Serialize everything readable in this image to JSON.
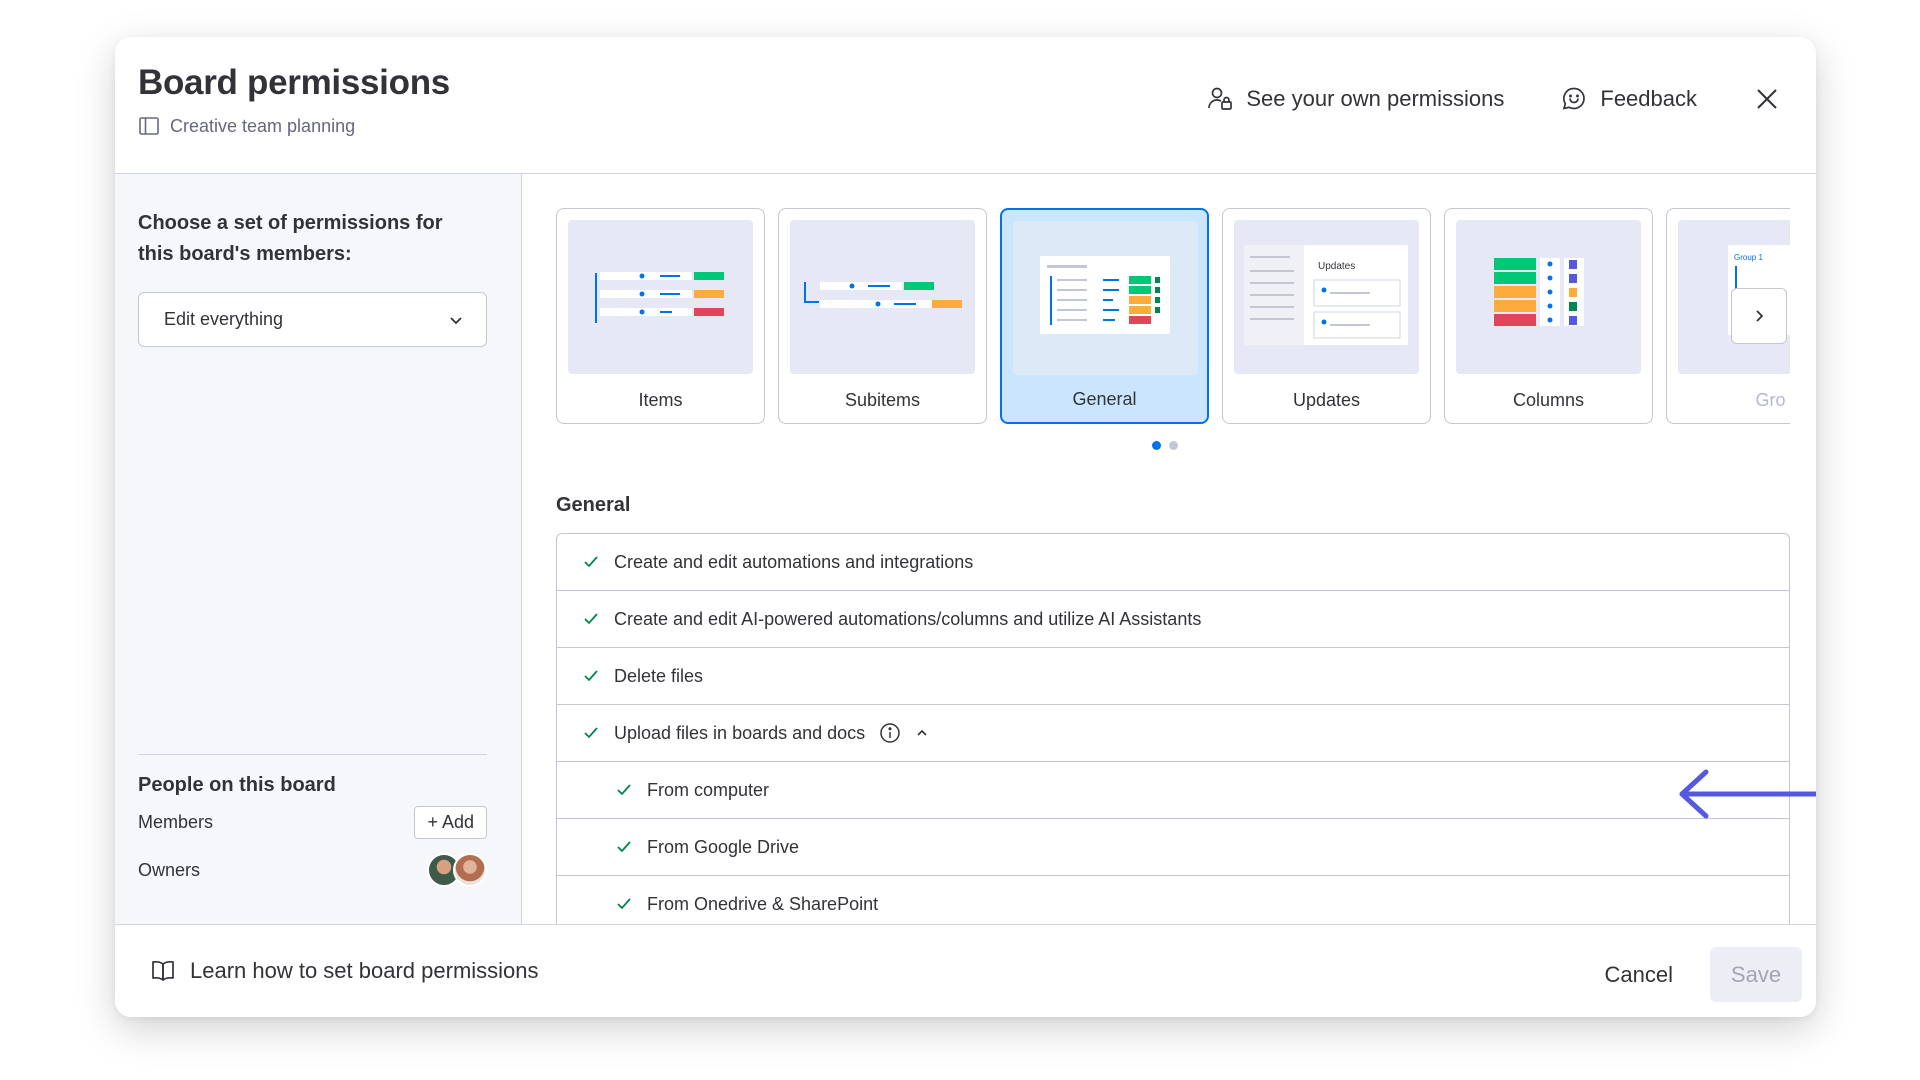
{
  "header": {
    "title": "Board permissions",
    "board_name": "Creative team planning",
    "see_permissions_label": "See your own permissions",
    "feedback_label": "Feedback"
  },
  "left_panel": {
    "choose_label": "Choose a set of permissions for this board's members:",
    "dropdown_value": "Edit everything",
    "people_title": "People on this board",
    "members_label": "Members",
    "add_label": "+ Add",
    "owners_label": "Owners"
  },
  "categories": [
    {
      "label": "Items",
      "selected": false
    },
    {
      "label": "Subitems",
      "selected": false
    },
    {
      "label": "General",
      "selected": true
    },
    {
      "label": "Updates",
      "selected": false
    },
    {
      "label": "Columns",
      "selected": false
    },
    {
      "label": "Gro",
      "selected": false
    }
  ],
  "thumb_text": {
    "updates": "Updates",
    "group": "Group 1"
  },
  "carousel": {
    "pages": 2,
    "current_page": 1
  },
  "section": {
    "title": "General",
    "permissions": [
      {
        "label": "Create and edit automations and integrations",
        "checked": true
      },
      {
        "label": "Create and edit AI-powered automations/columns and utilize AI Assistants",
        "checked": true
      },
      {
        "label": "Delete files",
        "checked": true
      },
      {
        "label": "Upload files in boards and docs",
        "checked": true,
        "expanded": true
      },
      {
        "label": "From computer",
        "checked": true
      },
      {
        "label": "From Google Drive",
        "checked": true
      },
      {
        "label": "From Onedrive & SharePoint",
        "checked": true
      }
    ]
  },
  "footer": {
    "learn_label": "Learn how to set board permissions",
    "cancel_label": "Cancel",
    "save_label": "Save"
  },
  "colors": {
    "accent": "#0073ea",
    "check": "#00854d",
    "arrow": "#5559df",
    "selected_card_bg": "#cce5ff"
  }
}
